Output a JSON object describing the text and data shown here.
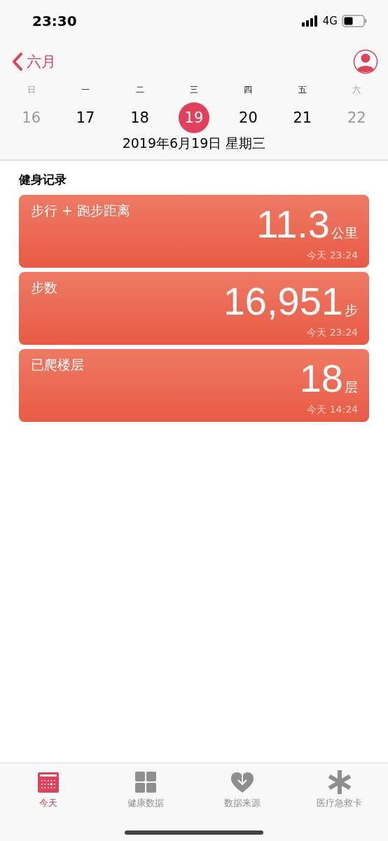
{
  "status_bar": {
    "time": "23:30",
    "network": "4G"
  },
  "nav": {
    "back_label": "六月"
  },
  "week": [
    {
      "weekday": "日",
      "day": "16",
      "weekend": true,
      "selected": false
    },
    {
      "weekday": "一",
      "day": "17",
      "weekend": false,
      "selected": false
    },
    {
      "weekday": "二",
      "day": "18",
      "weekend": false,
      "selected": false
    },
    {
      "weekday": "三",
      "day": "19",
      "weekend": false,
      "selected": true
    },
    {
      "weekday": "四",
      "day": "20",
      "weekend": false,
      "selected": false
    },
    {
      "weekday": "五",
      "day": "21",
      "weekend": false,
      "selected": false
    },
    {
      "weekday": "六",
      "day": "22",
      "weekend": true,
      "selected": false
    }
  ],
  "date_label": "2019年6月19日 星期三",
  "section_title": "健身记录",
  "cards": [
    {
      "title": "步行 + 跑步距离",
      "value": "11.3",
      "unit": "公里",
      "time": "今天 23:24"
    },
    {
      "title": "步数",
      "value": "16,951",
      "unit": "步",
      "time": "今天 23:24"
    },
    {
      "title": "已爬楼层",
      "value": "18",
      "unit": "层",
      "time": "今天 14:24"
    }
  ],
  "tabs": [
    {
      "kind": "calendar",
      "label": "今天",
      "selected": true
    },
    {
      "kind": "grid",
      "label": "健康数据",
      "selected": false
    },
    {
      "kind": "heart",
      "label": "数据来源",
      "selected": false
    },
    {
      "kind": "asterisk",
      "label": "医疗急救卡",
      "selected": false
    }
  ]
}
